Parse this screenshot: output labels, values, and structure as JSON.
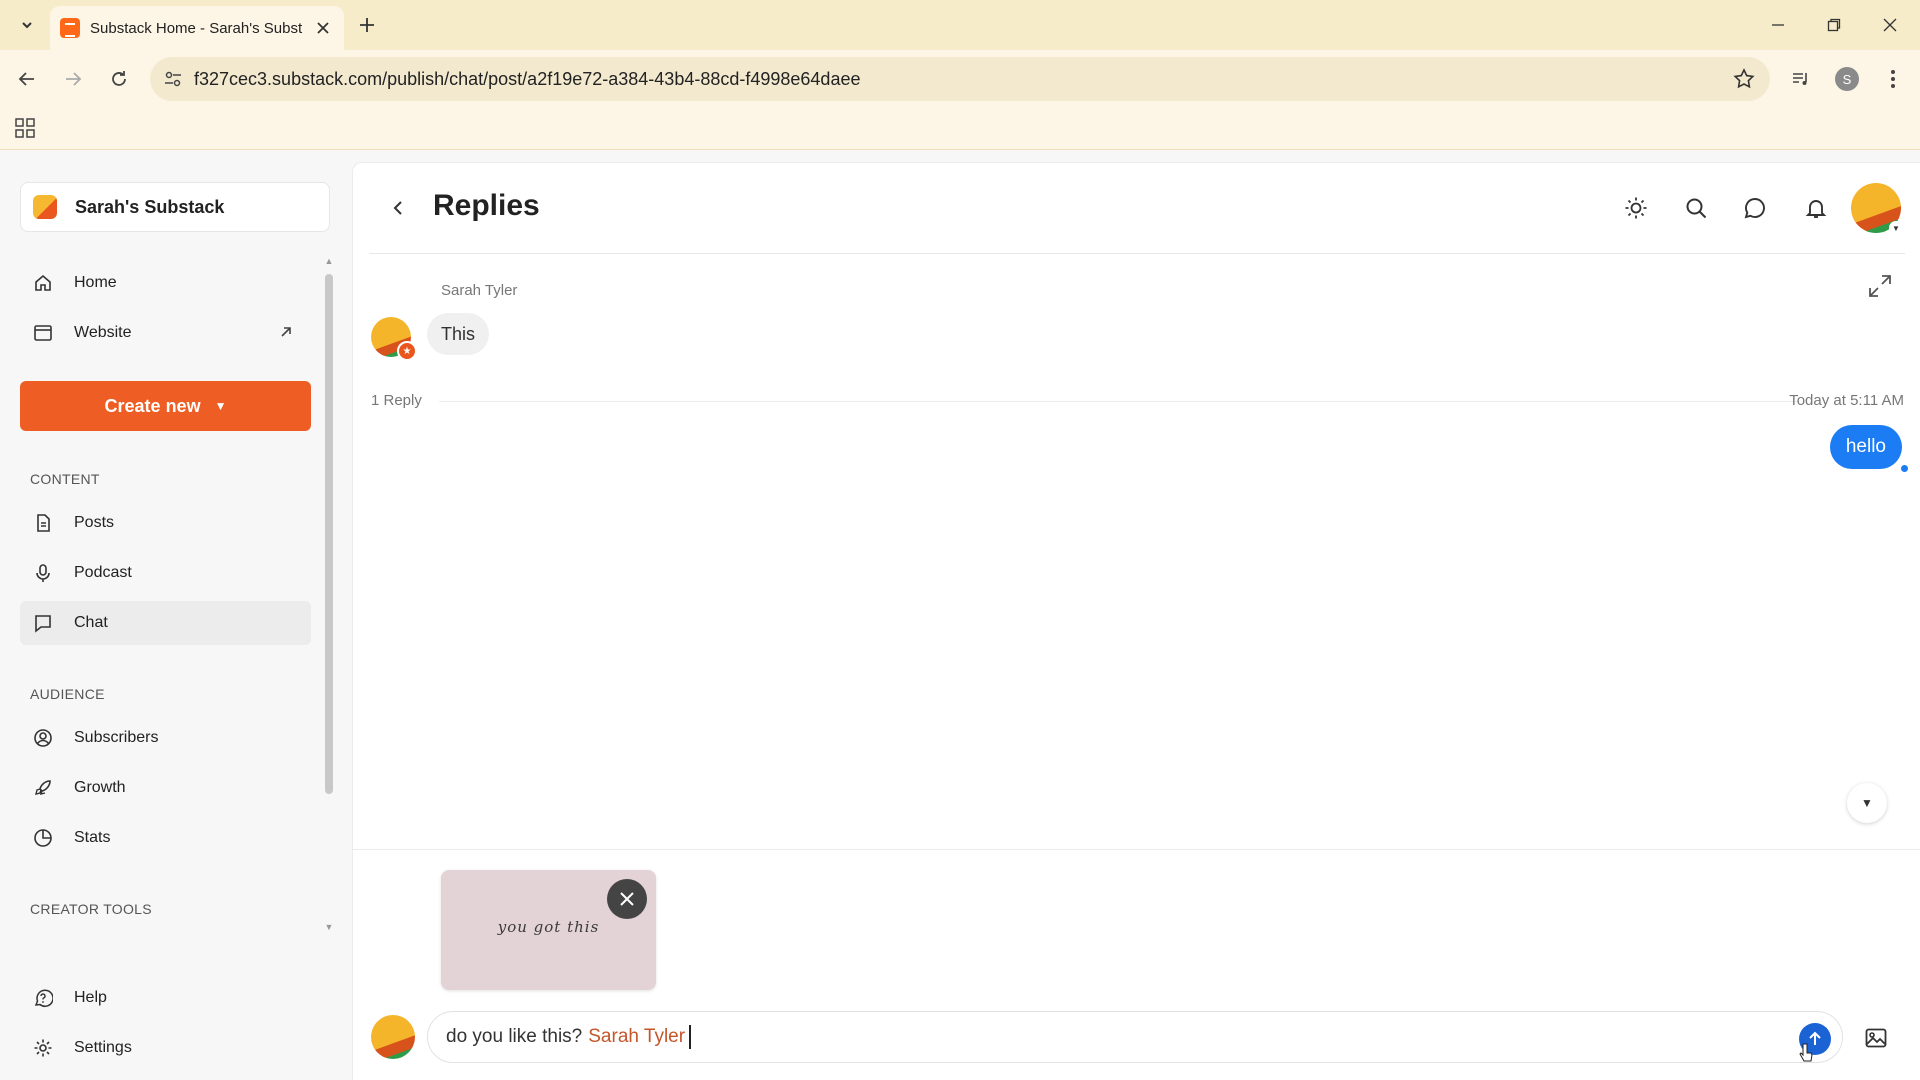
{
  "browser": {
    "tab_title": "Substack Home - Sarah's Subst",
    "url": "f327cec3.substack.com/publish/chat/post/a2f19e72-a384-43b4-88cd-f4998e64daee",
    "profile_initial": "S"
  },
  "sidebar": {
    "publication_name": "Sarah's Substack",
    "top_items": [
      {
        "label": "Home",
        "icon": "home-icon"
      },
      {
        "label": "Website",
        "icon": "website-icon"
      }
    ],
    "create_label": "Create new",
    "sections": {
      "content": "CONTENT",
      "audience": "AUDIENCE",
      "creator_tools": "CREATOR TOOLS"
    },
    "content_items": [
      {
        "label": "Posts",
        "icon": "document-icon"
      },
      {
        "label": "Podcast",
        "icon": "microphone-icon"
      },
      {
        "label": "Chat",
        "icon": "chat-icon",
        "active": true
      }
    ],
    "audience_items": [
      {
        "label": "Subscribers",
        "icon": "user-circle-icon"
      },
      {
        "label": "Growth",
        "icon": "rocket-icon"
      },
      {
        "label": "Stats",
        "icon": "pie-chart-icon"
      }
    ],
    "bottom_items": [
      {
        "label": "Help",
        "icon": "help-icon"
      },
      {
        "label": "Settings",
        "icon": "gear-icon"
      }
    ]
  },
  "header": {
    "title": "Replies"
  },
  "thread": {
    "author": "Sarah Tyler",
    "message": "This",
    "reply_count": "1 Reply",
    "timestamp": "Today at 5:11 AM",
    "my_reply": "hello"
  },
  "composer": {
    "attachment_text": "you got this",
    "text": "do you like this?",
    "mention": "Sarah Tyler"
  },
  "colors": {
    "accent": "#ee5d23",
    "bubble_blue": "#1b7cf4",
    "chrome": "#f6ecc9"
  }
}
